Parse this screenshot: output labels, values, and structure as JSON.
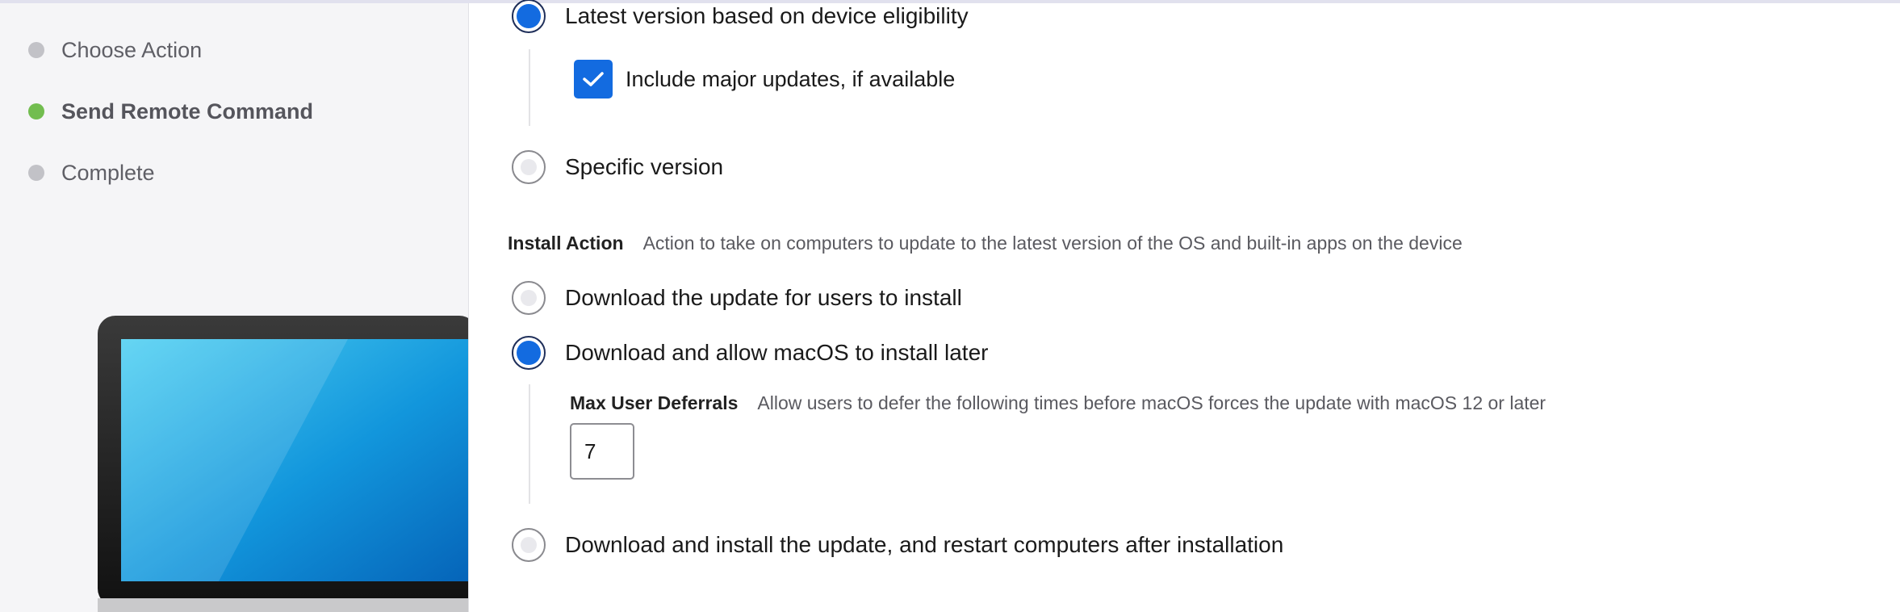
{
  "sidebar": {
    "steps": [
      {
        "label": "Choose Action",
        "state": "pending"
      },
      {
        "label": "Send Remote Command",
        "state": "active"
      },
      {
        "label": "Complete",
        "state": "pending"
      }
    ]
  },
  "version": {
    "options": [
      {
        "label": "Latest version based on device eligibility",
        "selected": true
      },
      {
        "label": "Specific version",
        "selected": false
      }
    ],
    "include_major_updates": {
      "label": "Include major updates, if available",
      "checked": true
    }
  },
  "install_action": {
    "title": "Install Action",
    "description": "Action to take on computers to update to the latest version of the OS and built-in apps on the device",
    "options": [
      {
        "label": "Download the update for users to install",
        "selected": false
      },
      {
        "label": "Download and allow macOS to install later",
        "selected": true
      },
      {
        "label": "Download and install the update, and restart computers after installation",
        "selected": false
      }
    ],
    "max_user_deferrals": {
      "title": "Max User Deferrals",
      "description": "Allow users to defer the following times before macOS forces the update with macOS 12 or later",
      "value": "7"
    }
  },
  "colors": {
    "accent": "#136be0",
    "active_step": "#72bd4f",
    "inactive_step": "#c2c2c7"
  }
}
